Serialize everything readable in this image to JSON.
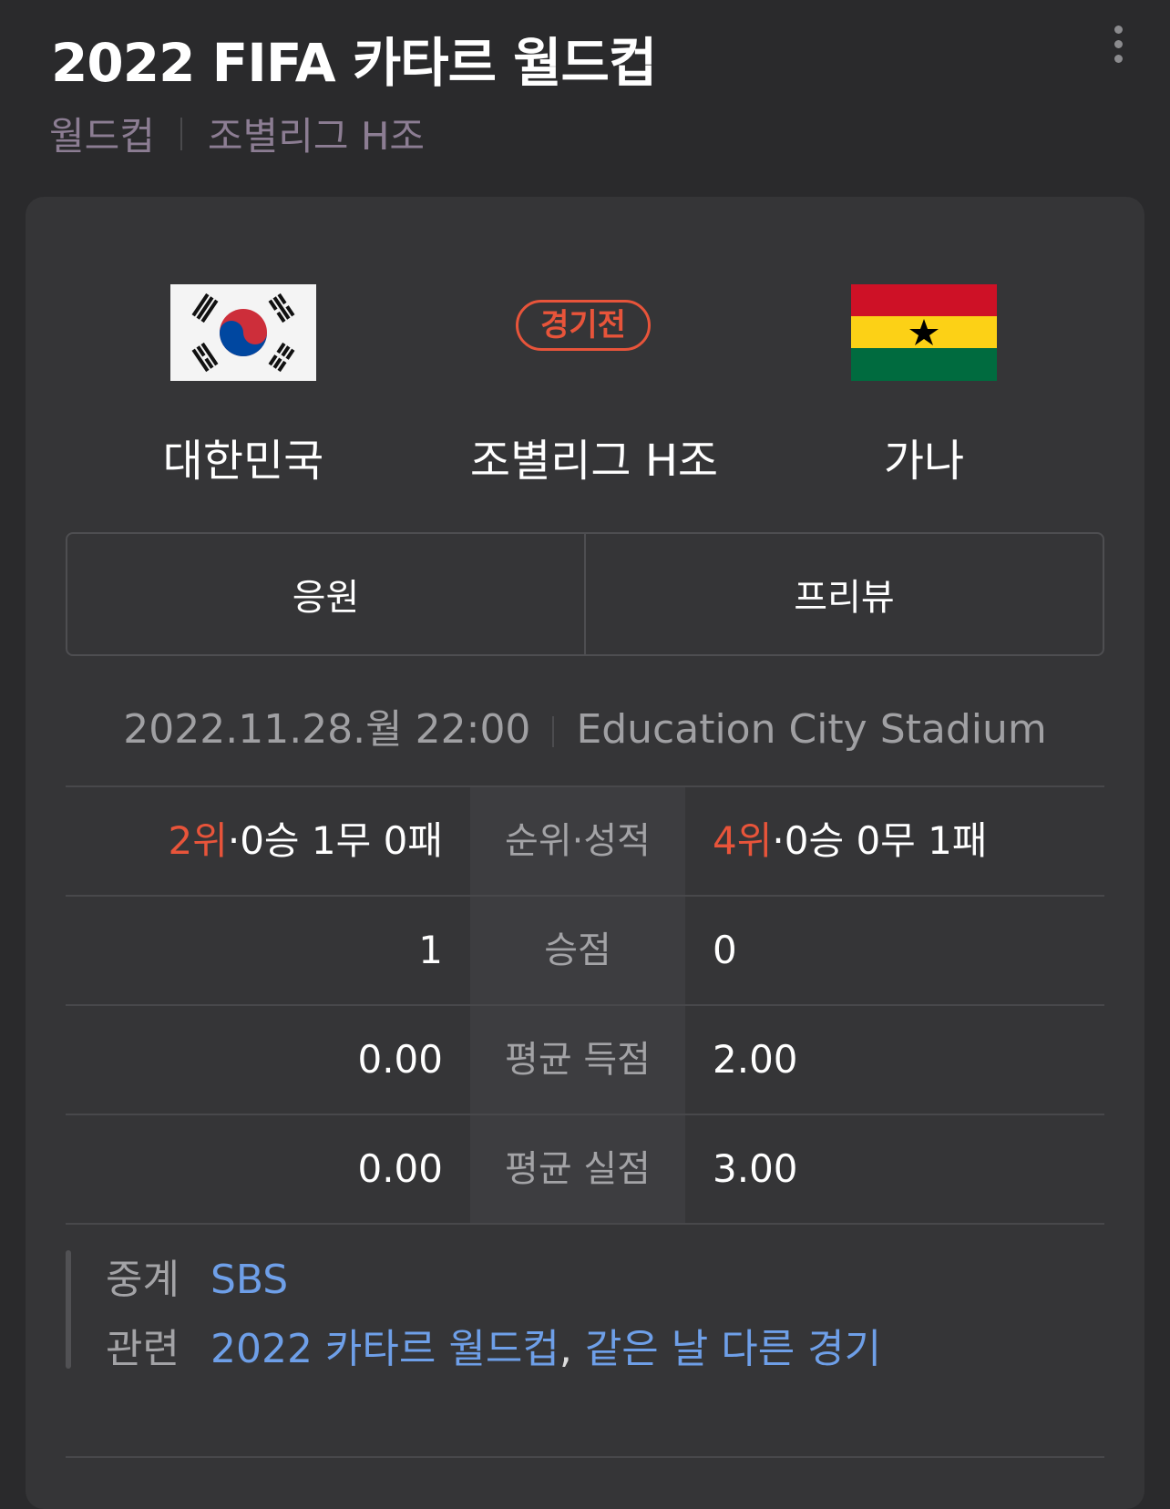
{
  "header": {
    "title": "2022 FIFA 카타르 월드컵",
    "breadcrumb": [
      "월드컵",
      "조별리그 H조"
    ]
  },
  "match": {
    "home": {
      "name": "대한민국",
      "flag": "south-korea-flag-icon"
    },
    "away": {
      "name": "가나",
      "flag": "ghana-flag-icon"
    },
    "status": "경기전",
    "stage": "조별리그 H조",
    "buttons": {
      "cheer": "응원",
      "preview": "프리뷰"
    },
    "datetime": "2022.11.28.월 22:00",
    "venue": "Education City Stadium"
  },
  "stats": {
    "rows": [
      {
        "label": "순위·성적",
        "home_rank": "2위",
        "home": "·0승 1무 0패",
        "away_rank": "4위",
        "away": "·0승 0무 1패"
      },
      {
        "label": "승점",
        "home_rank": "",
        "home": "1",
        "away_rank": "",
        "away": "0"
      },
      {
        "label": "평균 득점",
        "home_rank": "",
        "home": "0.00",
        "away_rank": "",
        "away": "2.00"
      },
      {
        "label": "평균 실점",
        "home_rank": "",
        "home": "0.00",
        "away_rank": "",
        "away": "3.00"
      }
    ]
  },
  "info": {
    "broadcast_label": "중계",
    "broadcast": "SBS",
    "related_label": "관련",
    "related_link1": "2022 카타르 월드컵",
    "related_sep": ",",
    "related_link2": "같은 날 다른 경기"
  },
  "colors": {
    "accent": "#e8543a",
    "link": "#6e9fe8",
    "background": "#2a2a2c",
    "card": "#353537"
  }
}
